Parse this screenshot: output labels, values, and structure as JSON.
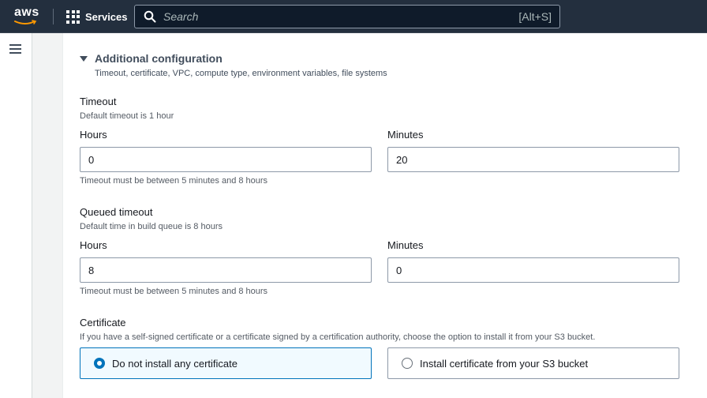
{
  "topnav": {
    "logo_text": "aws",
    "services_label": "Services",
    "search_placeholder": "Search",
    "search_shortcut": "[Alt+S]"
  },
  "config": {
    "title": "Additional configuration",
    "description": "Timeout, certificate, VPC, compute type, environment variables, file systems"
  },
  "timeout": {
    "label": "Timeout",
    "hint": "Default timeout is 1 hour",
    "hours_label": "Hours",
    "hours_value": "0",
    "minutes_label": "Minutes",
    "minutes_value": "20",
    "constraint": "Timeout must be between 5 minutes and 8 hours"
  },
  "queued_timeout": {
    "label": "Queued timeout",
    "hint": "Default time in build queue is 8 hours",
    "hours_label": "Hours",
    "hours_value": "8",
    "minutes_label": "Minutes",
    "minutes_value": "0",
    "constraint": "Timeout must be between 5 minutes and 8 hours"
  },
  "certificate": {
    "label": "Certificate",
    "hint": "If you have a self-signed certificate or a certificate signed by a certification authority, choose the option to install it from your S3 bucket.",
    "options": [
      {
        "label": "Do not install any certificate",
        "selected": true
      },
      {
        "label": "Install certificate from your S3 bucket",
        "selected": false
      }
    ]
  },
  "colors": {
    "nav_bg": "#232f3e",
    "accent": "#0073bb",
    "aws_orange": "#ff9900"
  }
}
